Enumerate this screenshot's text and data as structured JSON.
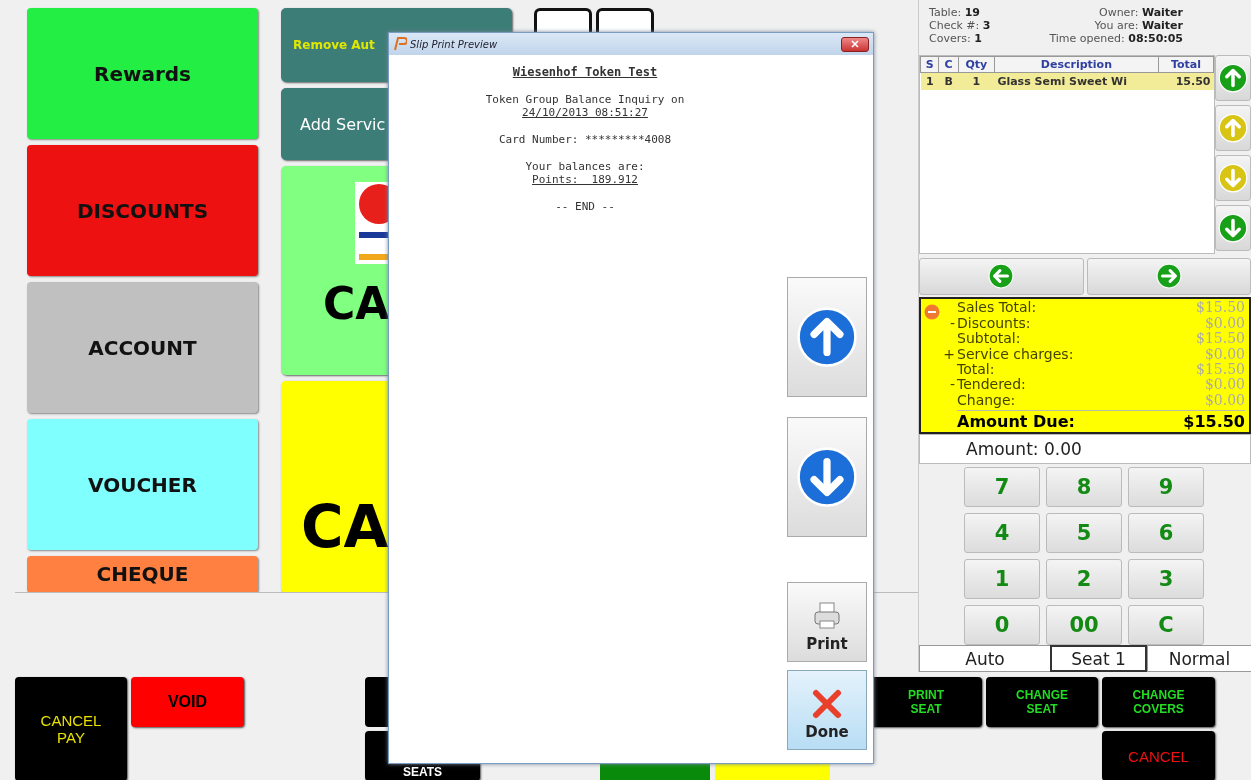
{
  "left_buttons": [
    {
      "label": "Rewards",
      "color": "#22ee44"
    },
    {
      "label": "DISCOUNTS",
      "color": "#ee1111"
    },
    {
      "label": "ACCOUNT",
      "color": "#c0c0c0"
    },
    {
      "label": "VOUCHER",
      "color": "#80ffff"
    },
    {
      "label": "CHEQUE",
      "color": "#ff8040"
    }
  ],
  "payment_buttons": [
    {
      "kind": "auto",
      "label": "Remove Aut"
    },
    {
      "kind": "service",
      "label": "Add Servic"
    },
    {
      "kind": "card",
      "label": "CA"
    },
    {
      "kind": "cash",
      "label": "CA"
    }
  ],
  "order_info": {
    "left": [
      {
        "label": "Table:",
        "value": "19"
      },
      {
        "label": "Check #:",
        "value": "3"
      },
      {
        "label": "Covers:",
        "value": "1"
      }
    ],
    "right": [
      {
        "label": "Owner:",
        "value": "Waiter"
      },
      {
        "label": "You are:",
        "value": "Waiter"
      },
      {
        "label": "Time opened:",
        "value": "08:50:05"
      }
    ]
  },
  "order_table": {
    "columns": [
      "S",
      "C",
      "Qty",
      "Description",
      "Total"
    ],
    "rows": [
      {
        "cells": [
          "1",
          "B",
          "1",
          "Glass Semi Sweet Wi",
          "15.50"
        ],
        "selected": true
      }
    ]
  },
  "totals": {
    "lines": [
      {
        "label": "Sales Total:",
        "value": "$15.50"
      },
      {
        "sign": "-",
        "label": "Discounts:",
        "value": "$0.00"
      },
      {
        "label": "Subtotal:",
        "value": "$15.50"
      },
      {
        "sign": "+",
        "label": "Service charges:",
        "value": "$0.00"
      },
      {
        "label": "Total:",
        "value": "$15.50"
      },
      {
        "sign": "-",
        "label": "Tendered:",
        "value": "$0.00"
      },
      {
        "label": "Change:",
        "value": "$0.00"
      }
    ],
    "due_label": "Amount Due:",
    "due_value": "$15.50"
  },
  "amount": "Amount: 0.00",
  "keypad": [
    "7",
    "8",
    "9",
    "4",
    "5",
    "6",
    "1",
    "2",
    "3",
    "0",
    "00",
    "C"
  ],
  "modes": [
    {
      "label": "Auto",
      "selected": false
    },
    {
      "label": "Seat 1",
      "selected": true
    },
    {
      "label": "Normal",
      "selected": false
    }
  ],
  "bottom_buttons": [
    {
      "kind": "cancel-pay",
      "lines": [
        "CANCEL",
        "PAY"
      ]
    },
    {
      "kind": "void",
      "lines": [
        "VOID"
      ]
    },
    {
      "kind": "seats",
      "lines": [
        "SEATS"
      ]
    },
    {
      "kind": "print-seat",
      "lines": [
        "PRINT",
        "SEAT"
      ]
    },
    {
      "kind": "change-seat",
      "lines": [
        "CHANGE",
        "SEAT"
      ]
    },
    {
      "kind": "change-covers",
      "lines": [
        "CHANGE",
        "COVERS"
      ]
    },
    {
      "kind": "cancel",
      "lines": [
        "CANCEL"
      ]
    }
  ],
  "dialog": {
    "title": "Slip Print Preview",
    "receipt": [
      {
        "kind": "title",
        "text": "Wiesenhof Token Test"
      },
      {
        "kind": "gap"
      },
      {
        "kind": "plain",
        "text": "Token Group Balance Inquiry on"
      },
      {
        "kind": "underline",
        "text": "24/10/2013 08:51:27"
      },
      {
        "kind": "gap"
      },
      {
        "kind": "plain",
        "text": "Card Number: *********4008"
      },
      {
        "kind": "gap"
      },
      {
        "kind": "plain",
        "text": "Your balances are:"
      },
      {
        "kind": "underline",
        "text": "Points:  189.912"
      },
      {
        "kind": "gap"
      },
      {
        "kind": "plain",
        "text": "-- END --"
      }
    ],
    "buttons": [
      {
        "kind": "print",
        "label": "Print"
      },
      {
        "kind": "done",
        "label": "Done"
      }
    ]
  }
}
